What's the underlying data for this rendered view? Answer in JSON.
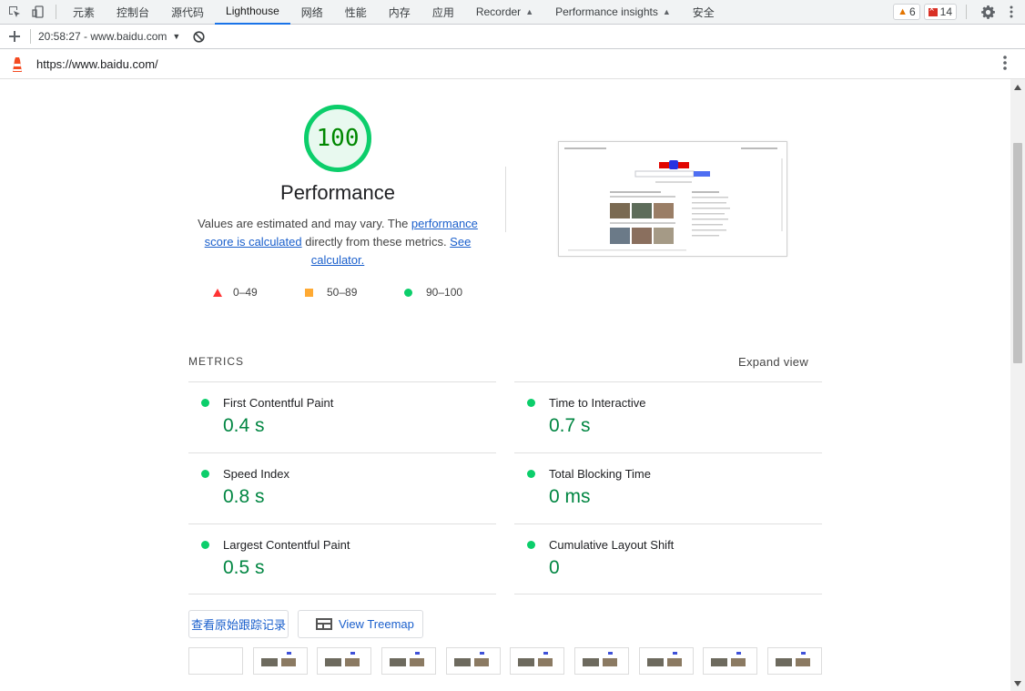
{
  "toolbar": {
    "tabs": [
      {
        "label": "元素"
      },
      {
        "label": "控制台"
      },
      {
        "label": "源代码"
      },
      {
        "label": "Lighthouse"
      },
      {
        "label": "网络"
      },
      {
        "label": "性能"
      },
      {
        "label": "内存"
      },
      {
        "label": "应用"
      },
      {
        "label": "Recorder"
      },
      {
        "label": "Performance insights"
      },
      {
        "label": "安全"
      }
    ],
    "warnings_count": "6",
    "errors_count": "14"
  },
  "subbar": {
    "report_selector": "20:58:27 - www.baidu.com"
  },
  "urlbar": {
    "url": "https://www.baidu.com/"
  },
  "performance": {
    "score": "100",
    "title": "Performance",
    "desc_pre": "Values are estimated and may vary. The ",
    "desc_link1": "performance score is calculated",
    "desc_mid": " directly from these metrics. ",
    "desc_link2": "See calculator.",
    "legend": [
      {
        "range": "0–49"
      },
      {
        "range": "50–89"
      },
      {
        "range": "90–100"
      }
    ],
    "colors": {
      "pass": "#0cce6b",
      "average": "#ffaa33",
      "fail": "#ff3333"
    }
  },
  "metrics": {
    "header": "METRICS",
    "expand_label": "Expand view",
    "items": [
      {
        "label": "First Contentful Paint",
        "value": "0.4 s"
      },
      {
        "label": "Time to Interactive",
        "value": "0.7 s"
      },
      {
        "label": "Speed Index",
        "value": "0.8 s"
      },
      {
        "label": "Total Blocking Time",
        "value": "0 ms"
      },
      {
        "label": "Largest Contentful Paint",
        "value": "0.5 s"
      },
      {
        "label": "Cumulative Layout Shift",
        "value": "0"
      }
    ]
  },
  "actions": {
    "trace_button": "查看原始跟踪记录",
    "treemap_button": "View Treemap"
  }
}
